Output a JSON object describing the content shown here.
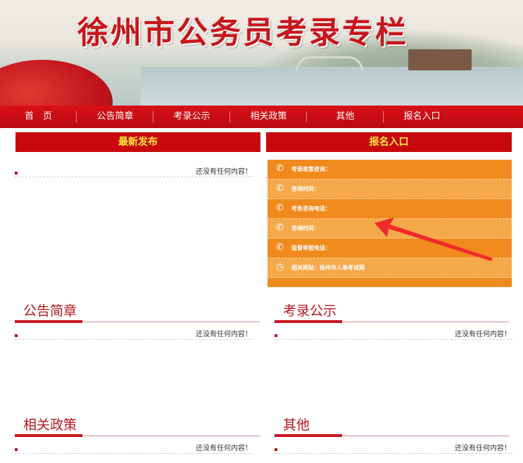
{
  "banner": {
    "title": "徐州市公务员考录专栏"
  },
  "nav": {
    "items": [
      "首　页",
      "公告简章",
      "考录公示",
      "相关政策",
      "其他",
      "报名入口"
    ]
  },
  "latest": {
    "title": "最新发布",
    "empty": "还没有任何内容！"
  },
  "signup": {
    "title": "报名入口",
    "rows": [
      {
        "icon": "phone-icon",
        "label": "考录政策咨询："
      },
      {
        "icon": "phone-icon",
        "label": "咨询时间："
      },
      {
        "icon": "phone-icon",
        "label": "考务咨询电话："
      },
      {
        "icon": "phone-icon",
        "label": "咨询时间："
      },
      {
        "icon": "phone-icon",
        "label": "监督举报电话："
      },
      {
        "icon": "clock-icon",
        "label": "相关网站：徐州市人事考试网"
      }
    ]
  },
  "sections": [
    {
      "title": "公告简章",
      "empty": "还没有任何内容！"
    },
    {
      "title": "考录公示",
      "empty": "还没有任何内容！"
    },
    {
      "title": "相关政策",
      "empty": "还没有任何内容！"
    },
    {
      "title": "其他",
      "empty": "还没有任何内容！"
    }
  ],
  "colors": {
    "brand_red": "#c8080d",
    "accent_yellow": "#ffeb3b",
    "panel_orange": "#f08a1c"
  }
}
